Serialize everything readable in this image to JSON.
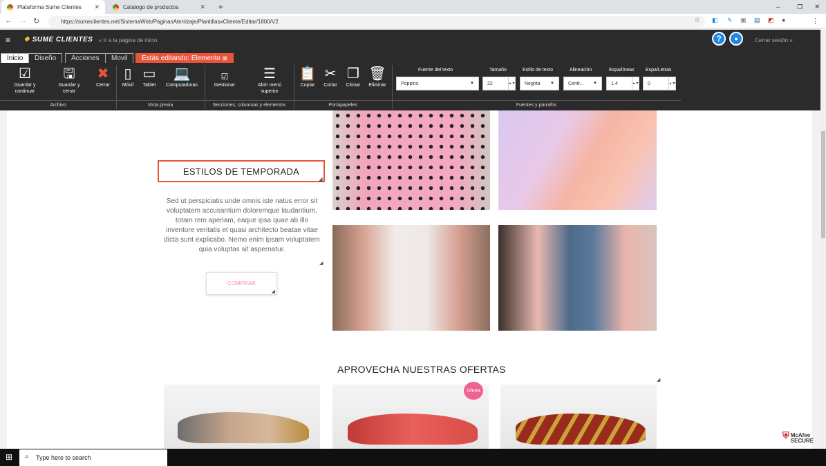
{
  "browser": {
    "tabs": [
      {
        "title": "Plataforma Sume Clientes"
      },
      {
        "title": "Catalogo de productos"
      }
    ],
    "url": "https://sumeclientes.net/SistemaWeb/PaginasAterrizaje/PlantillasxCliente/Editar/1800/V2"
  },
  "header": {
    "logo": "SUME CLIENTES",
    "back_link": "« Ir a la página de inicio",
    "help": "?",
    "logout": "Cerrar sesión »"
  },
  "ribbon_tabs": [
    "Inicio",
    "Diseño",
    "Acciones",
    "Movil",
    "Estás editando: Elemento"
  ],
  "ribbon": {
    "archivo": {
      "label": "Archivo",
      "buttons": [
        "Guardar y continuar",
        "Guardar y cerrar",
        "Cerrar"
      ]
    },
    "vista": {
      "label": "Vista previa",
      "buttons": [
        "Móvil",
        "Tablet",
        "Computadoras"
      ]
    },
    "secciones": {
      "label": "Secciones, columnas y elementos",
      "buttons": [
        "Gestionar",
        "Abrir menú superior"
      ]
    },
    "portapapeles": {
      "label": "Portapapeles",
      "buttons": [
        "Copiar",
        "Cortar",
        "Clonar",
        "Eliminar"
      ]
    },
    "fuentes": {
      "label": "Fuentes y párrafos",
      "font_label": "Fuente del texto",
      "font_value": "Poppins",
      "size_label": "Tamaño",
      "size_value": "22",
      "style_label": "Estilo de texto",
      "style_value": "Negrita",
      "align_label": "Alineación",
      "align_value": "Centr...",
      "line_label": "Espa/líneas",
      "line_value": "1.4",
      "letter_label": "Espa/Letras",
      "letter_value": "0"
    }
  },
  "content": {
    "season_title": "ESTILOS DE TEMPORADA",
    "paragraph": "Sed ut perspiciatis unde omnis iste natus error sit voluptatem accusantium doloremque laudantium, totam rem aperiam, eaque ipsa quae ab illo inventore veritatis et quasi architecto beatae vitae dicta sunt explicabo. Nemo enim ipsam voluptatem quia voluptas sit aspernatur.",
    "buy_button": "COMPRAR",
    "offers_title": "APROVECHA NUESTRAS OFERTAS",
    "offer_badge": "Oferta"
  },
  "mcafee": "McAfee SECURE",
  "taskbar": {
    "search_placeholder": "Type here to search"
  },
  "colors": {
    "accent": "#e8553b",
    "toolbar": "#2b2b2b",
    "pink": "#f090c0"
  }
}
